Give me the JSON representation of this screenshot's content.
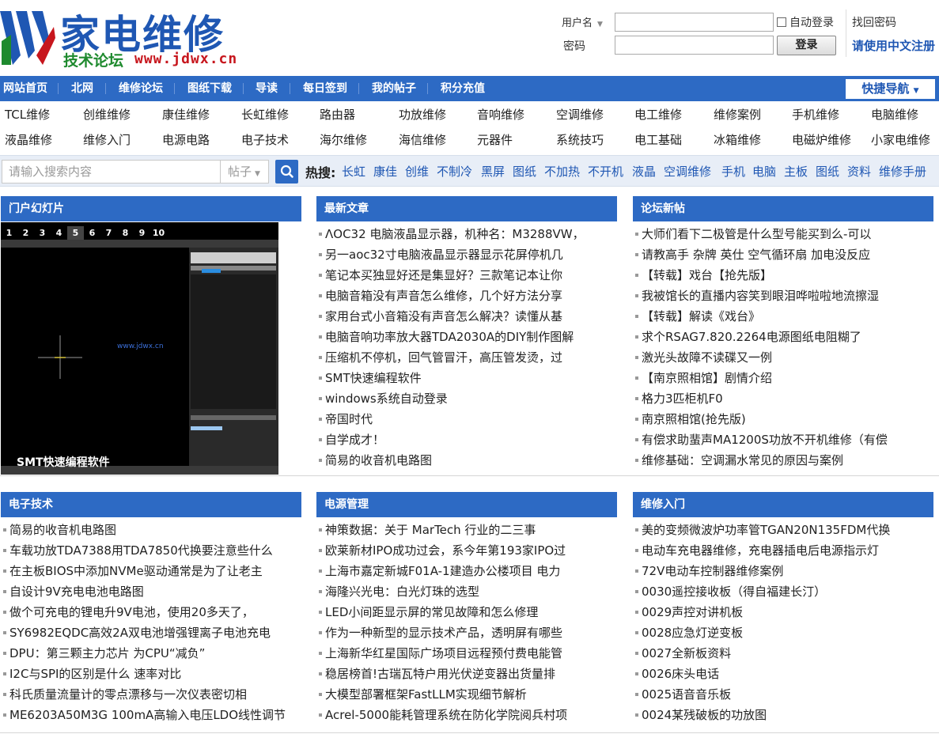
{
  "logo": {
    "title": "家电维修",
    "subtitle": "技术论坛",
    "url": "www.jdwx.cn"
  },
  "login": {
    "username_label": "用户名",
    "password_label": "密码",
    "remember_label": "自动登录",
    "login_button": "登录",
    "find_password": "找回密码",
    "chinese_register": "请使用中文注册"
  },
  "nav": {
    "items": [
      "网站首页",
      "北网",
      "维修论坛",
      "图纸下载",
      "导读",
      "每日签到",
      "我的帖子",
      "积分充值"
    ],
    "quick_nav": "快捷导航"
  },
  "categories": {
    "row1": [
      "TCL维修",
      "创维维修",
      "康佳维修",
      "长虹维修",
      "路由器",
      "功放维修",
      "音响维修",
      "空调维修",
      "电工维修",
      "维修案例",
      "手机维修",
      "电脑维修"
    ],
    "row2": [
      "液晶维修",
      "维修入门",
      "电源电路",
      "电子技术",
      "海尔维修",
      "海信维修",
      "元器件",
      "系统技巧",
      "电工基础",
      "冰箱维修",
      "电磁炉维修",
      "小家电维修"
    ]
  },
  "search": {
    "placeholder": "请输入搜索内容",
    "type": "帖子",
    "hot_label": "热搜:",
    "hot_words": [
      "长虹",
      "康佳",
      "创维",
      "不制冷",
      "黑屏",
      "图纸",
      "不加热",
      "不开机",
      "液晶",
      "空调维修",
      "手机",
      "电脑",
      "主板",
      "图纸",
      "资料",
      "维修手册"
    ]
  },
  "slideshow": {
    "header": "门户幻灯片",
    "numbers": [
      "1",
      "2",
      "3",
      "4",
      "5",
      "6",
      "7",
      "8",
      "9",
      "10"
    ],
    "active": "5",
    "caption": "SMT快速编程软件",
    "watermark": "www.jdwx.cn"
  },
  "latest": {
    "header": "最新文章",
    "items": [
      "ΛOC32 电脑液晶显示器，机种名：M3288VW，",
      "另一aoc32寸电脑液晶显示器显示花屏停机几",
      "笔记本买独显好还是集显好？三款笔记本让你",
      "电脑音箱没有声音怎么维修，几个好方法分享",
      "家用台式小音箱没有声音怎么解决？读懂从基",
      "电脑音响功率放大器TDA2030A的DIY制作图解",
      "压缩机不停机，回气管冒汗，高压管发烫，过",
      "SMT快速编程软件",
      "windows系统自动登录",
      "帝国时代",
      "自学成才！",
      "简易的收音机电路图"
    ]
  },
  "forum": {
    "header": "论坛新帖",
    "items": [
      "大师们看下二极管是什么型号能买到么-可以",
      "请教高手 杂牌 英仕 空气循环扇 加电没反应",
      "【转载】戏台【抢先版】",
      "我被馆长的直播内容笑到眼泪哗啦啦地流擦湿",
      "【转载】解读《戏台》",
      "求个RSAG7.820.2264电源图纸电阻糊了",
      "激光头故障不读碟又一例",
      "【南京照相馆】剧情介绍",
      "格力3匹柜机F0",
      "南京照相馆(抢先版)",
      "有偿求助蜚声MA1200S功放不开机维修（有偿",
      "维修基础：空调漏水常见的原因与案例"
    ]
  },
  "electronics": {
    "header": "电子技术",
    "items": [
      "简易的收音机电路图",
      "车载功放TDA7388用TDA7850代换要注意些什么",
      "在主板BIOS中添加NVMe驱动通常是为了让老主",
      "自设计9V充电电池电路图",
      "做个可充电的锂电升9V电池，使用20多天了，",
      "SY6982EQDC高效2A双电池增强锂离子电池充电",
      "DPU：第三颗主力芯片 为CPU“减负”",
      "I2C与SPI的区别是什么 速率对比",
      "科氏质量流量计的零点漂移与一次仪表密切相",
      "ME6203A50M3G 100mA高输入电压LDO线性调节"
    ]
  },
  "power": {
    "header": "电源管理",
    "items": [
      "神策数据：关于 MarTech 行业的二三事",
      "欧莱新材IPO成功过会，系今年第193家IPO过",
      "上海市嘉定新城F01A-1建造办公楼项目 电力",
      "海隆兴光电：白光灯珠的选型",
      "LED小间距显示屏的常见故障和怎么修理",
      "作为一种新型的显示技术产品，透明屏有哪些",
      "上海新华红星国际广场项目远程预付费电能管",
      "稳居榜首!古瑞瓦特户用光伏逆变器出货量排",
      "大模型部署框架FastLLM实现细节解析",
      "Acrel-5000能耗管理系统在防化学院阅兵村项"
    ]
  },
  "repair": {
    "header": "维修入门",
    "items": [
      "美的变频微波炉功率管TGAN20N135FDM代换",
      "电动车充电器维修，充电器插电后电源指示灯",
      "72V电动车控制器维修案例",
      "0030遥控接收板（得自福建长汀）",
      "0029声控对讲机板",
      "0028应急灯逆变板",
      "0027全新板资料",
      "0026床头电话",
      "0025语音音乐板",
      "0024某残破板的功放图"
    ]
  },
  "colors": {
    "brand_blue": "#2d6ac4",
    "logo_green": "#1e8a2e",
    "logo_red": "#c7161d"
  }
}
